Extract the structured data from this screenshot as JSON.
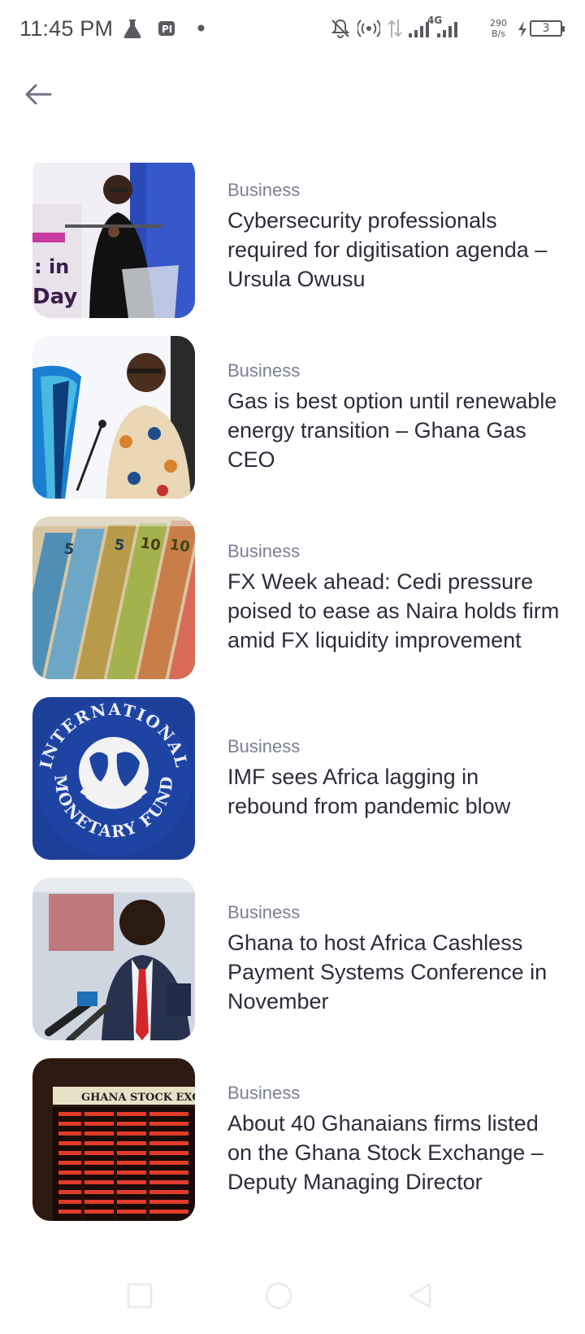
{
  "status_bar": {
    "time": "11:45 PM",
    "network_type": "4G",
    "speed_value": "290",
    "speed_unit": "B/s",
    "battery_level": "3",
    "icons": [
      "flask-icon",
      "pi-icon",
      "dot-icon",
      "bell-off-icon",
      "hotspot-icon",
      "data-arrows-icon",
      "signal-icon",
      "signal-icon",
      "charging-icon"
    ]
  },
  "header": {
    "back_icon": "arrow-left-icon"
  },
  "articles": [
    {
      "category": "Business",
      "title": "Cybersecurity professionals required for digitisation agenda – Ursula Owusu",
      "image": "speaker-at-podium"
    },
    {
      "category": "Business",
      "title": "Gas is best option until renewable energy transition – Ghana Gas CEO",
      "image": "man-at-microphone"
    },
    {
      "category": "Business",
      "title": "FX Week ahead: Cedi pressure poised to ease as Naira holds firm amid FX liquidity improvement",
      "image": "cedi-banknotes"
    },
    {
      "category": "Business",
      "title": "IMF sees Africa lagging in rebound from pandemic blow",
      "image": "imf-seal"
    },
    {
      "category": "Business",
      "title": "Ghana to host Africa Cashless Payment Systems Conference in November",
      "image": "man-speaking-at-mics"
    },
    {
      "category": "Business",
      "title": "About 40 Ghanaians firms listed on the Ghana Stock Exchange – Deputy Managing Director",
      "image": "stock-exchange-board"
    }
  ],
  "images": {
    "imf_seal_top": "INTERNATIONAL",
    "imf_seal_bottom": "MONETARY FUND",
    "stock_board_header": "GHANA STOCK EXC"
  },
  "nav_bar": {
    "icons": [
      "recent-apps-icon",
      "home-icon",
      "back-icon"
    ]
  },
  "colors": {
    "category": "#7b7f96",
    "headline": "#2b2d3b",
    "background": "#ffffff"
  }
}
